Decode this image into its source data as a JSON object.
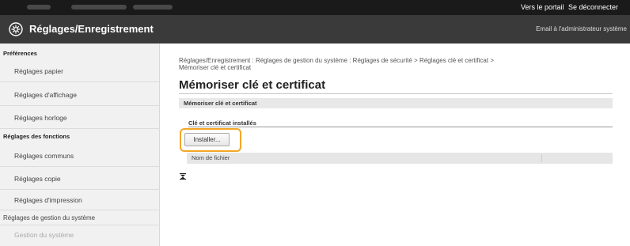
{
  "topbar": {
    "portal_link": "Vers le portail",
    "logout_link": "Se déconnecter"
  },
  "header": {
    "app_title": "Réglages/Enregistrement",
    "email_admin": "Email à l'administrateur système",
    "logo_icon": "gear-icon"
  },
  "sidebar": {
    "group_preferences": "Préférences",
    "preferences_items": [
      "Réglages papier",
      "Réglages d'affichage",
      "Réglages horloge"
    ],
    "group_functions": "Réglages des fonctions",
    "functions_items": [
      "Réglages communs",
      "Réglages copie",
      "Réglages d'impression"
    ],
    "group_system": "Réglages de gestion du système",
    "system_items": [
      "Gestion du système"
    ]
  },
  "main": {
    "breadcrumb_line1": "Réglages/Enregistrement : Réglages de gestion du système : Réglages de sécurité > Réglages clé et certificat >",
    "breadcrumb_line2": "Mémoriser clé et certificat",
    "page_title": "Mémoriser clé et certificat",
    "section_title": "Mémoriser clé et certificat",
    "sub_heading": "Clé et certificat installés",
    "install_button": "Installer...",
    "table_col_filename": "Nom de fichier",
    "sort_icon": "sort-icon"
  },
  "colors": {
    "topbar_bg": "#1a1a1a",
    "header_bg": "#3a3a3a",
    "highlight": "#f5a623"
  }
}
